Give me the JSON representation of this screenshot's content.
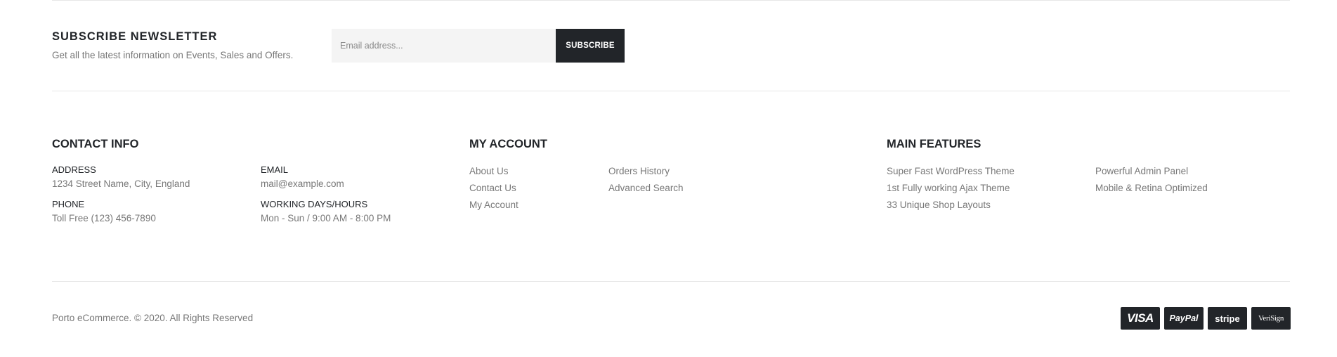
{
  "newsletter": {
    "title": "SUBSCRIBE NEWSLETTER",
    "subtitle": "Get all the latest information on Events, Sales and Offers.",
    "email_placeholder": "Email address...",
    "subscribe_label": "SUBSCRIBE"
  },
  "contact": {
    "title": "CONTACT INFO",
    "address_label": "ADDRESS",
    "address_value": "1234 Street Name, City, England",
    "email_label": "EMAIL",
    "email_value": "mail@example.com",
    "phone_label": "PHONE",
    "phone_value": "Toll Free (123) 456-7890",
    "hours_label": "WORKING DAYS/HOURS",
    "hours_value": "Mon - Sun / 9:00 AM - 8:00 PM"
  },
  "account": {
    "title": "MY ACCOUNT",
    "links": [
      "About Us",
      "Contact Us",
      "My Account",
      "Orders History",
      "Advanced Search"
    ]
  },
  "features": {
    "title": "MAIN FEATURES",
    "links": [
      "Super Fast WordPress Theme",
      "1st Fully working Ajax Theme",
      "33 Unique Shop Layouts",
      "Powerful Admin Panel",
      "Mobile & Retina Optimized"
    ]
  },
  "footer": {
    "copyright": "Porto eCommerce. © 2020. All Rights Reserved",
    "payments": [
      "VISA",
      "PayPal",
      "stripe",
      "VeriSign"
    ]
  },
  "colors": {
    "dark": "#222529",
    "text": "#777777",
    "input_bg": "#f4f4f4",
    "divider": "#e7e7e7"
  }
}
